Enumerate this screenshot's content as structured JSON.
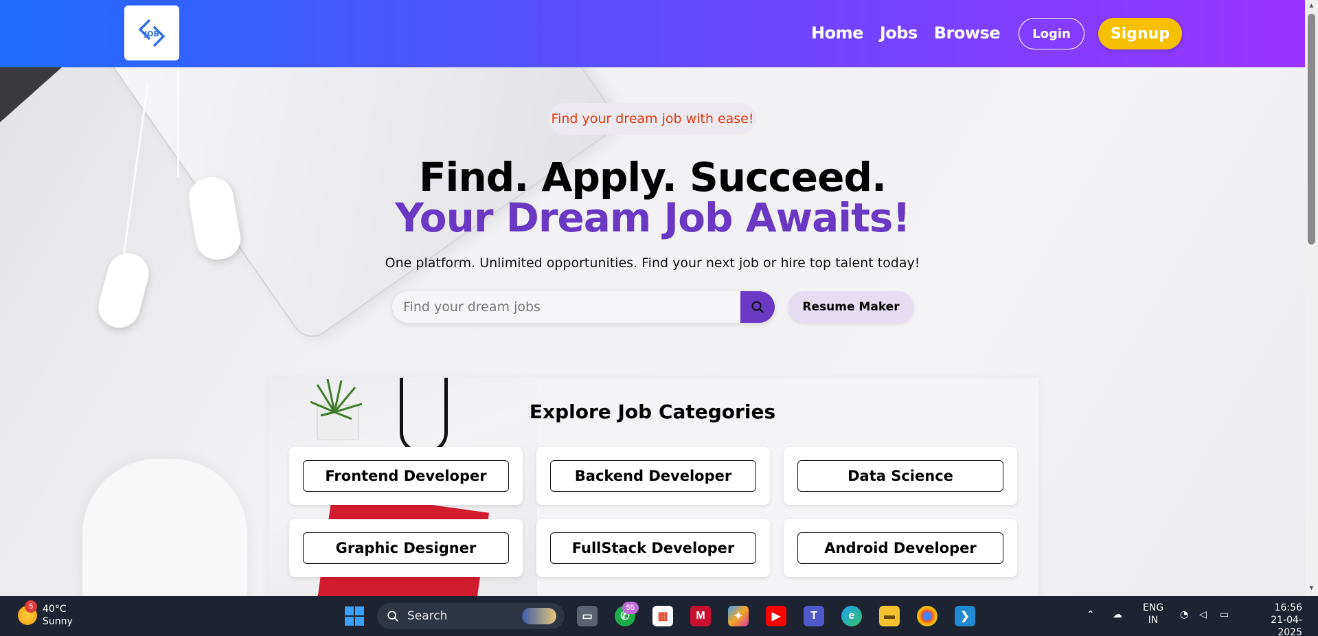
{
  "nav": {
    "logo_text": "JOB",
    "links": [
      "Home",
      "Jobs",
      "Browse"
    ],
    "login_label": "Login",
    "signup_label": "Signup"
  },
  "hero": {
    "tagline": "Find your dream job with ease!",
    "headline_1": "Find. Apply. Succeed.",
    "headline_2": "Your Dream Job Awaits!",
    "subtext": "One platform. Unlimited opportunities. Find your next job or hire top talent today!",
    "search_placeholder": "Find your dream jobs",
    "resume_button": "Resume Maker"
  },
  "categories": {
    "title": "Explore Job Categories",
    "items": [
      "Frontend Developer",
      "Backend Developer",
      "Data Science",
      "Graphic Designer",
      "FullStack Developer",
      "Android Developer"
    ]
  },
  "colors": {
    "accent": "#6a38c2",
    "tagline": "#e0380e",
    "signup": "#f6c000"
  },
  "taskbar": {
    "weather_badge": "5",
    "temperature": "40°C",
    "condition": "Sunny",
    "search_label": "Search",
    "whatsapp_badge": "55",
    "lang_1": "ENG",
    "lang_2": "IN",
    "time": "16:56",
    "date": "21-04-2025"
  }
}
